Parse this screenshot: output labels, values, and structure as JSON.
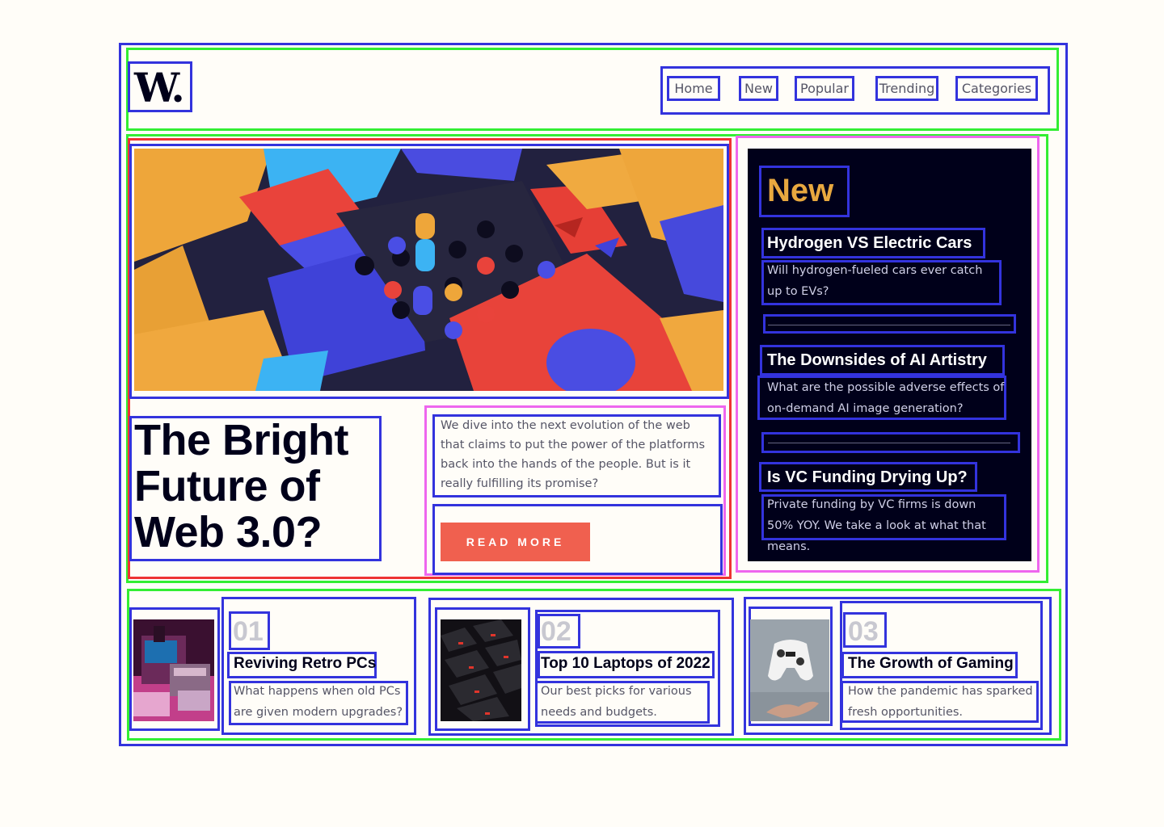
{
  "brand": {
    "logo": "W."
  },
  "nav": {
    "items": [
      "Home",
      "New",
      "Popular",
      "Trending",
      "Categories"
    ]
  },
  "feature": {
    "title": "The Bright Future of Web 3.0?",
    "description": "We dive into the next evolution of the web that claims to put the power of the platforms back into the hands of the people. But is it really fulfilling its promise?",
    "cta": "READ MORE"
  },
  "new_section": {
    "heading": "New",
    "items": [
      {
        "title": "Hydrogen VS Electric Cars",
        "summary": "Will hydrogen-fueled cars ever catch up to EVs?"
      },
      {
        "title": "The Downsides of AI Artistry",
        "summary": "What are the possible adverse effects of on-demand AI image generation?"
      },
      {
        "title": "Is VC Funding Drying Up?",
        "summary": "Private funding by VC firms is down 50% YOY. We take a look at what that means."
      }
    ]
  },
  "cards": [
    {
      "number": "01",
      "title": "Reviving Retro PCs",
      "summary": "What happens when old PCs are given modern upgrades?"
    },
    {
      "number": "02",
      "title": "Top 10 Laptops of 2022",
      "summary": "Our best picks for various needs and budgets."
    },
    {
      "number": "03",
      "title": "The Growth of Gaming",
      "summary": "How the pandemic has sparked fresh opportunities."
    }
  ],
  "colors": {
    "accent": "#f0604f",
    "new_heading": "#e8a83f",
    "dark_panel": "#00001a",
    "background": "#fffdf8"
  }
}
